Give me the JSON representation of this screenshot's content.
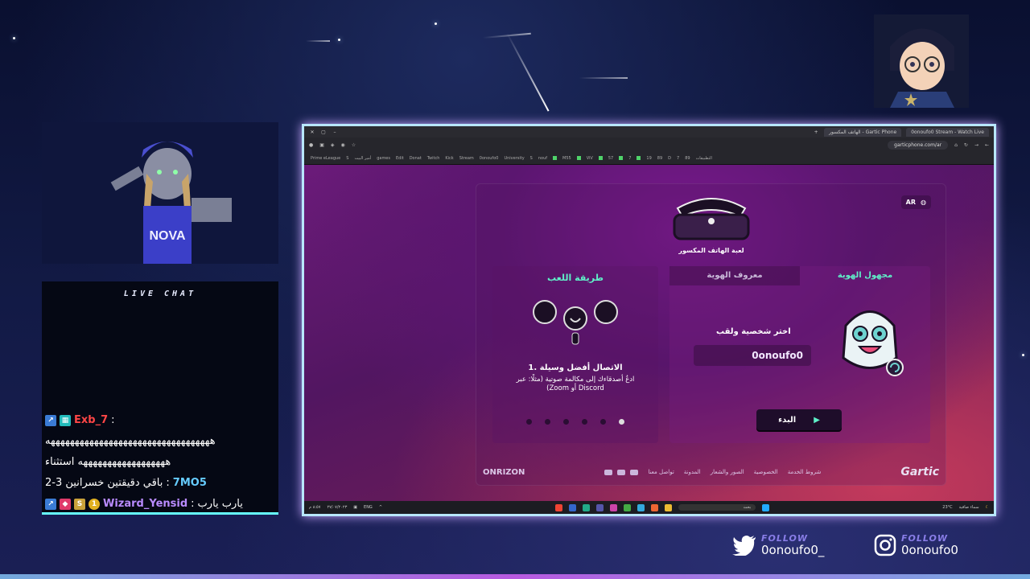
{
  "overlay": {
    "chat_title": "LIVE CHAT",
    "chat_messages": [
      {
        "user": "Exb_7",
        "sep": ":",
        "text": ""
      },
      {
        "user": "",
        "sep": "",
        "text": "ههههههههههههههههههههههههههههههههههه"
      },
      {
        "user": "",
        "sep": "",
        "text": "ههههههههههههههههههه استثناء"
      },
      {
        "user": "7MO5",
        "sep": ":",
        "text": "باقي دقيقتين خسرانين 3-2"
      },
      {
        "user": "Wizard_Yensid",
        "sep": ":",
        "text": "يارب يارب"
      }
    ],
    "webcam_shirt_text": "NOVA",
    "follow_twitter": {
      "label": "FOLLOW",
      "user": "0onoufo0_"
    },
    "follow_instagram": {
      "label": "FOLLOW",
      "user": "0onoufo0"
    }
  },
  "browser": {
    "tabs": [
      "Gartic Phone - الهاتف المكسور",
      "0onoufo0 Stream - Watch Live"
    ],
    "address": "garticphone.com/ar",
    "bookmarks": [
      "Prime eLeague",
      "S",
      "أمير البيت",
      "games",
      "Edit",
      "Donat",
      "Twitch",
      "Kick",
      "Stream",
      "0onoufo0",
      "University",
      "S",
      "nouf",
      "M55",
      "ViV",
      "57",
      "7",
      "19",
      "89",
      "D",
      "7",
      "89",
      "التطبيقات"
    ]
  },
  "gartic": {
    "lang": "AR",
    "logo_subtitle": "لعبة الهاتف المكسور",
    "howto": {
      "title": "طريقة اللعب",
      "step_title": "1. الاتصال أفضل وسيلة",
      "step_text": "ادعُ أصدقاءك إلى مكالمة صوتية (مثلًا: عبر Discord أو Zoom)",
      "dots": 6,
      "active_dot": 5
    },
    "tabs": {
      "anonymous": "مجهول الهوية",
      "known": "معروف الهوية"
    },
    "pick_label": "اختر شخصية ولقب",
    "nickname": "0onoufo0",
    "start_label": "البدء",
    "footer": {
      "brand": "Gartic",
      "links": [
        "شروط الخدمة",
        "الخصوصية",
        "الصور والشعار",
        "المدونة",
        "تواصل معنا"
      ],
      "partner": "ONRIZON"
    }
  },
  "taskbar": {
    "search": "بحث",
    "lang": "ENG",
    "weather_temp": "23°C",
    "weather_text": "سماء صافية",
    "time": "٨:٥٧ م",
    "date": "٢٧/٠٧/٢٠٢٣"
  }
}
